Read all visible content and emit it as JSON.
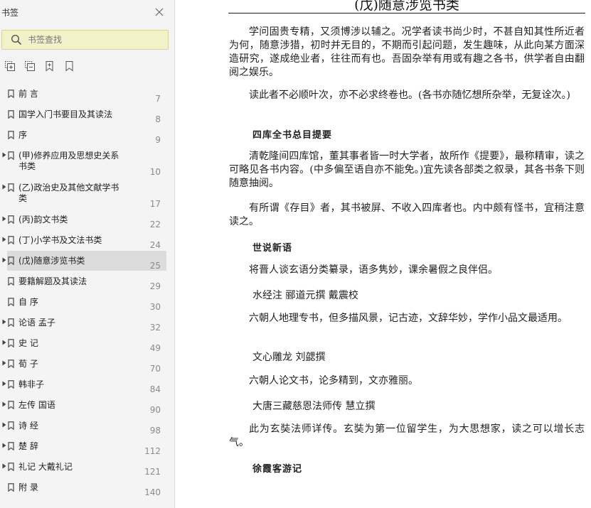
{
  "sidebar": {
    "title": "书签",
    "close_icon": "close-icon",
    "search": {
      "placeholder": "书签查找",
      "value": ""
    },
    "tools": [
      "expand-all-icon",
      "collapse-all-icon",
      "add-bookmark-icon",
      "bookmark-icon"
    ],
    "items": [
      {
        "label": "前 言",
        "page": "7",
        "expandable": false,
        "selected": false,
        "tall": false
      },
      {
        "label": "国学入门书要目及其读法",
        "page": "8",
        "expandable": false,
        "selected": false,
        "tall": false
      },
      {
        "label": "序",
        "page": "9",
        "expandable": false,
        "selected": false,
        "tall": false
      },
      {
        "label": "(甲)修养应用及思想史关系书类",
        "page": "10",
        "expandable": true,
        "selected": false,
        "tall": true
      },
      {
        "label": "(乙)政治史及其他文献学书类",
        "page": "17",
        "expandable": true,
        "selected": false,
        "tall": true
      },
      {
        "label": "(丙)韵文书类",
        "page": "22",
        "expandable": true,
        "selected": false,
        "tall": false
      },
      {
        "label": "(丁)小学书及文法书类",
        "page": "24",
        "expandable": true,
        "selected": false,
        "tall": false
      },
      {
        "label": "(戊)随意涉览书类",
        "page": "25",
        "expandable": true,
        "selected": true,
        "tall": false
      },
      {
        "label": "要籍解题及其读法",
        "page": "29",
        "expandable": false,
        "selected": false,
        "tall": false
      },
      {
        "label": "自 序",
        "page": "30",
        "expandable": false,
        "selected": false,
        "tall": false
      },
      {
        "label": "论语 孟子",
        "page": "32",
        "expandable": true,
        "selected": false,
        "tall": false
      },
      {
        "label": "史 记",
        "page": "49",
        "expandable": true,
        "selected": false,
        "tall": false
      },
      {
        "label": "荀 子",
        "page": "70",
        "expandable": true,
        "selected": false,
        "tall": false
      },
      {
        "label": "韩非子",
        "page": "84",
        "expandable": true,
        "selected": false,
        "tall": false
      },
      {
        "label": "左传 国语",
        "page": "90",
        "expandable": true,
        "selected": false,
        "tall": false
      },
      {
        "label": "诗 经",
        "page": "98",
        "expandable": true,
        "selected": false,
        "tall": false
      },
      {
        "label": "楚 辞",
        "page": "112",
        "expandable": true,
        "selected": false,
        "tall": false
      },
      {
        "label": "礼记 大戴礼记",
        "page": "121",
        "expandable": true,
        "selected": false,
        "tall": false
      },
      {
        "label": "附 录",
        "page": "140",
        "expandable": false,
        "selected": false,
        "tall": false
      }
    ]
  },
  "document": {
    "title": "(戊)随意涉览书类",
    "blocks": [
      {
        "kind": "para",
        "text": "学问固贵专精，又须博涉以辅之。况学者读书尚少时，不甚自知其性所近者为何，随意涉猎，初时并无目的，不期而引起问题，发生趣味，从此向某方面深造研究，遂成绝业者，往往而有也。吾固杂举有用或有趣之各书，供学者自由翻阅之娱乐。"
      },
      {
        "kind": "para",
        "text": "读此者不必顺叶次，亦不必求终卷也。(各书亦随忆想所杂举，无复诠次。)"
      },
      {
        "kind": "heading",
        "text": "四库全书总目提要"
      },
      {
        "kind": "para",
        "text": "清乾隆间四库馆，董其事者皆一时大学者，故所作《提要》，最称精审，读之可略见各书内容。(中多偏至语自亦不能免。)宜先读各部类之叙录，其各书条下则随意抽阅。"
      },
      {
        "kind": "para",
        "text": "有所谓《存目》者，其书被屏、不收入四库者也。内中颇有怪书，宜稍注意读之。"
      },
      {
        "kind": "heading",
        "text": "世说新语"
      },
      {
        "kind": "para",
        "text": "将晋人谈玄语分类纂录，语多隽妙，课余暑假之良伴侣。"
      },
      {
        "kind": "subhead",
        "text": "水经注 郦道元撰 戴震校"
      },
      {
        "kind": "para",
        "text": "六朝人地理专书，但多描风景，记古迹，文辞华妙，学作小品文最适用。"
      },
      {
        "kind": "subhead",
        "text": "文心雕龙 刘勰撰"
      },
      {
        "kind": "para",
        "text": "六朝人论文书，论多精到，文亦雅丽。"
      },
      {
        "kind": "subhead",
        "text": "大唐三藏慈恩法师传 慧立撰"
      },
      {
        "kind": "para",
        "text": "此为玄奘法师详传。玄奘为第一位留学生，为大思想家，读之可以增长志气。"
      },
      {
        "kind": "heading",
        "text": "徐霞客游记"
      }
    ]
  }
}
